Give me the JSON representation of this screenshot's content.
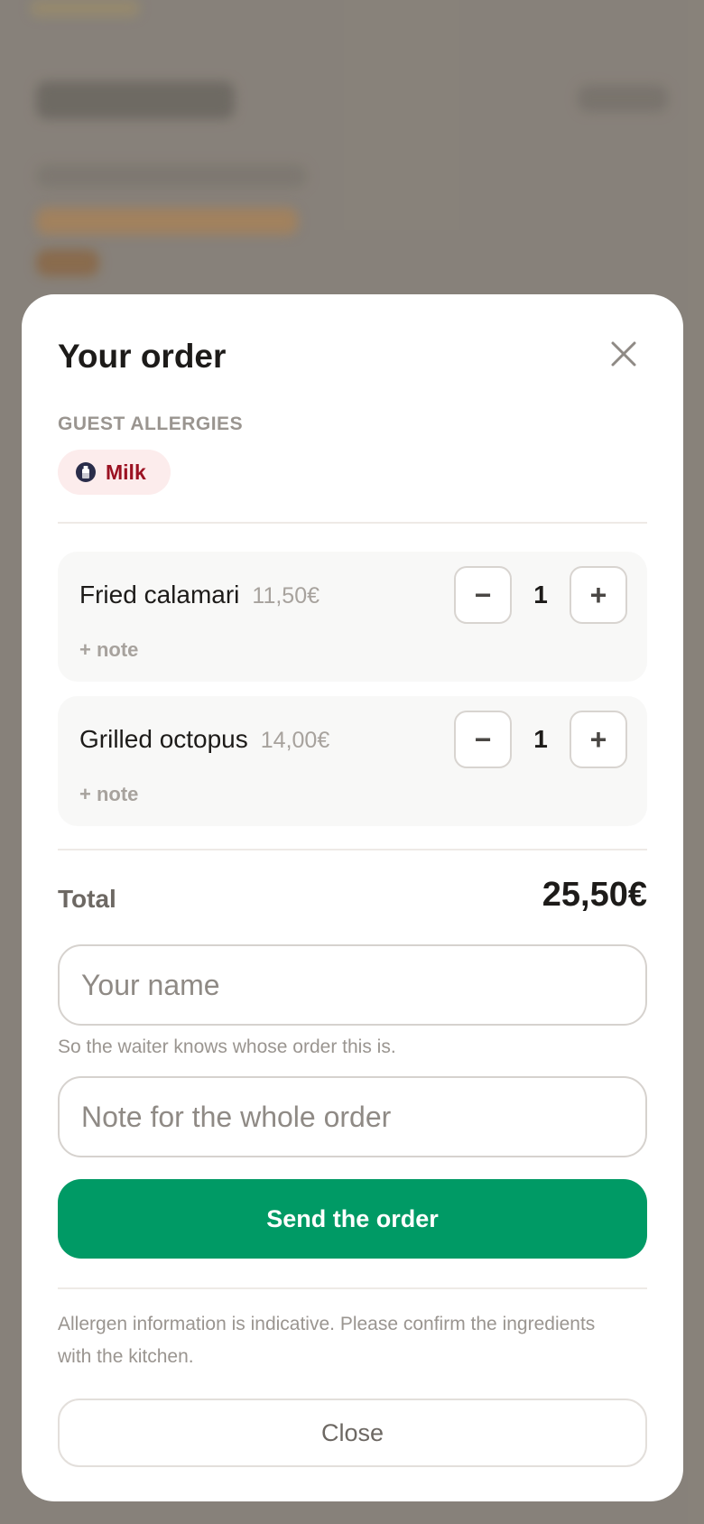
{
  "modal": {
    "title": "Your order",
    "close_icon": "close-icon"
  },
  "allergies": {
    "label": "GUEST ALLERGIES",
    "items": [
      {
        "label": "Milk",
        "icon": "milk-bottle-icon"
      }
    ]
  },
  "items": [
    {
      "name": "Fried calamari",
      "price": "11,50€",
      "quantity": "1",
      "note": "+ note",
      "minus": "−",
      "plus": "+"
    },
    {
      "name": "Grilled octopus",
      "price": "14,00€",
      "quantity": "1",
      "note": "+ note",
      "minus": "−",
      "plus": "+"
    }
  ],
  "total": {
    "label": "Total",
    "value": "25,50€"
  },
  "name_field": {
    "placeholder": "Your name",
    "hint": "So the waiter knows whose order this is."
  },
  "note_field": {
    "placeholder": "Note for the whole order"
  },
  "send_button": {
    "label": "Send the order"
  },
  "disclaimer": "Allergen information is indicative. Please confirm the ingredients with the kitchen.",
  "close_button": {
    "label": "Close"
  },
  "colors": {
    "accent": "#009a65",
    "allergy_chip_bg": "#fcecec",
    "allergy_text": "#9b1122"
  }
}
